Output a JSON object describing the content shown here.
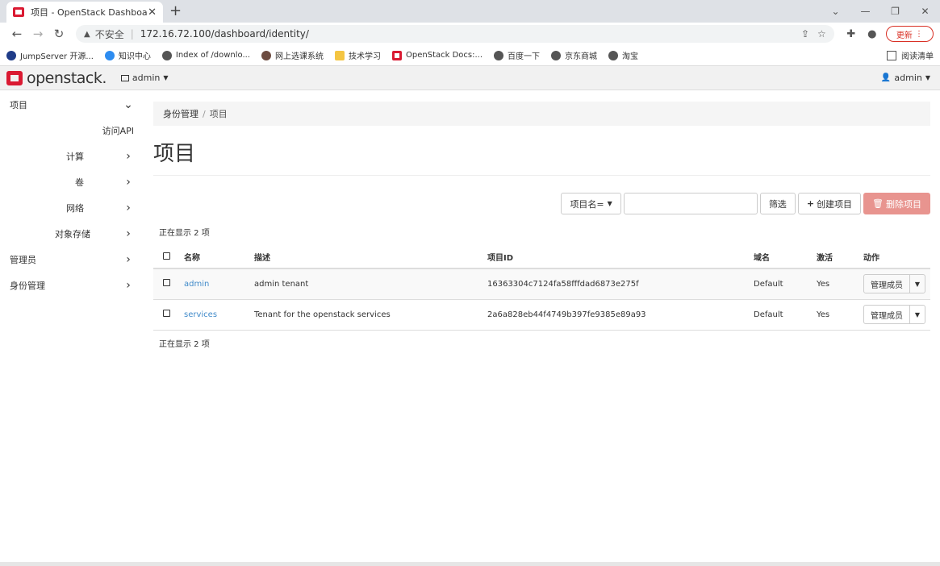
{
  "browser": {
    "tab_title": "项目 - OpenStack Dashboard",
    "url_warning": "不安全",
    "url": "172.16.72.100/dashboard/identity/",
    "update_label": "更新",
    "bookmarks": [
      {
        "label": "JumpServer 开源...",
        "icon": "js"
      },
      {
        "label": "知识中心",
        "icon": "blue"
      },
      {
        "label": "Index of /downlo...",
        "icon": "globe"
      },
      {
        "label": "网上选课系统",
        "icon": "cap"
      },
      {
        "label": "技术学习",
        "icon": "folder"
      },
      {
        "label": "OpenStack Docs:...",
        "icon": "os"
      },
      {
        "label": "百度一下",
        "icon": "globe"
      },
      {
        "label": "京东商城",
        "icon": "globe"
      },
      {
        "label": "淘宝",
        "icon": "globe"
      }
    ],
    "reading_list": "阅读清单"
  },
  "header": {
    "logo": "openstack.",
    "project": "admin",
    "user": "admin"
  },
  "sidebar": {
    "project": "项目",
    "access_api": "访问API",
    "compute": "计算",
    "volumes": "卷",
    "network": "网络",
    "object_store": "对象存储",
    "admin": "管理员",
    "identity": "身份管理"
  },
  "breadcrumb": {
    "parent": "身份管理",
    "current": "项目"
  },
  "page_title": "项目",
  "filter": {
    "field_label": "项目名=",
    "filter_btn": "筛选",
    "create_btn": "创建项目",
    "delete_btn": "删除项目"
  },
  "count_text": "正在显示 2 项",
  "table": {
    "headers": {
      "name": "名称",
      "desc": "描述",
      "id": "项目ID",
      "domain": "域名",
      "enabled": "激活",
      "actions": "动作"
    },
    "rows": [
      {
        "name": "admin",
        "desc": "admin tenant",
        "id": "16363304c7124fa58fffdad6873e275f",
        "domain": "Default",
        "enabled": "Yes",
        "action": "管理成员"
      },
      {
        "name": "services",
        "desc": "Tenant for the openstack services",
        "id": "2a6a828eb44f4749b397fe9385e89a93",
        "domain": "Default",
        "enabled": "Yes",
        "action": "管理成员"
      }
    ]
  }
}
